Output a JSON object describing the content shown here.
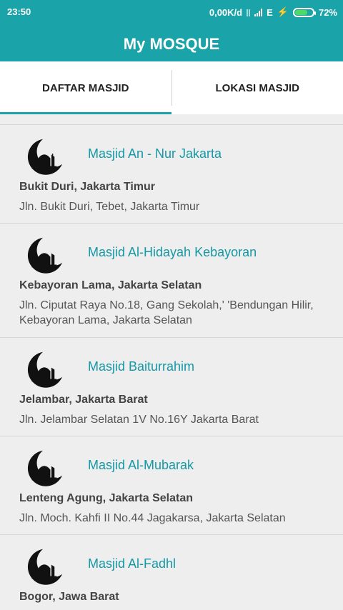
{
  "status": {
    "time": "23:50",
    "speed": "0,00K/d",
    "network": "E",
    "battery": "72%"
  },
  "appbar": {
    "title": "My MOSQUE"
  },
  "tabs": [
    {
      "label": "DAFTAR MASJID",
      "active": true
    },
    {
      "label": "LOKASI MASJID",
      "active": false
    }
  ],
  "mosques": [
    {
      "name": "Masjid An - Nur Jakarta",
      "area": "Bukit Duri, Jakarta Timur",
      "address": "Jln. Bukit Duri, Tebet, Jakarta Timur",
      "icon": "crescent-mosque-icon"
    },
    {
      "name": "Masjid Al-Hidayah Kebayoran",
      "area": "Kebayoran Lama, Jakarta Selatan",
      "address": "Jln. Ciputat Raya No.18, Gang Sekolah,' 'Bendungan Hilir, Kebayoran Lama, Jakarta Selatan",
      "icon": "crescent-mosque-icon"
    },
    {
      "name": "Masjid Baiturrahim",
      "area": "Jelambar, Jakarta Barat",
      "address": "Jln. Jelambar Selatan 1V No.16Y Jakarta Barat",
      "icon": "crescent-mosque-icon"
    },
    {
      "name": "Masjid Al-Mubarak",
      "area": "Lenteng Agung, Jakarta Selatan",
      "address": "Jln. Moch. Kahfi II No.44 Jagakarsa, Jakarta Selatan",
      "icon": "crescent-mosque-icon"
    },
    {
      "name": "Masjid Al-Fadhl",
      "area": "Bogor, Jawa Barat",
      "address": "",
      "icon": "crescent-mosque-icon"
    }
  ]
}
